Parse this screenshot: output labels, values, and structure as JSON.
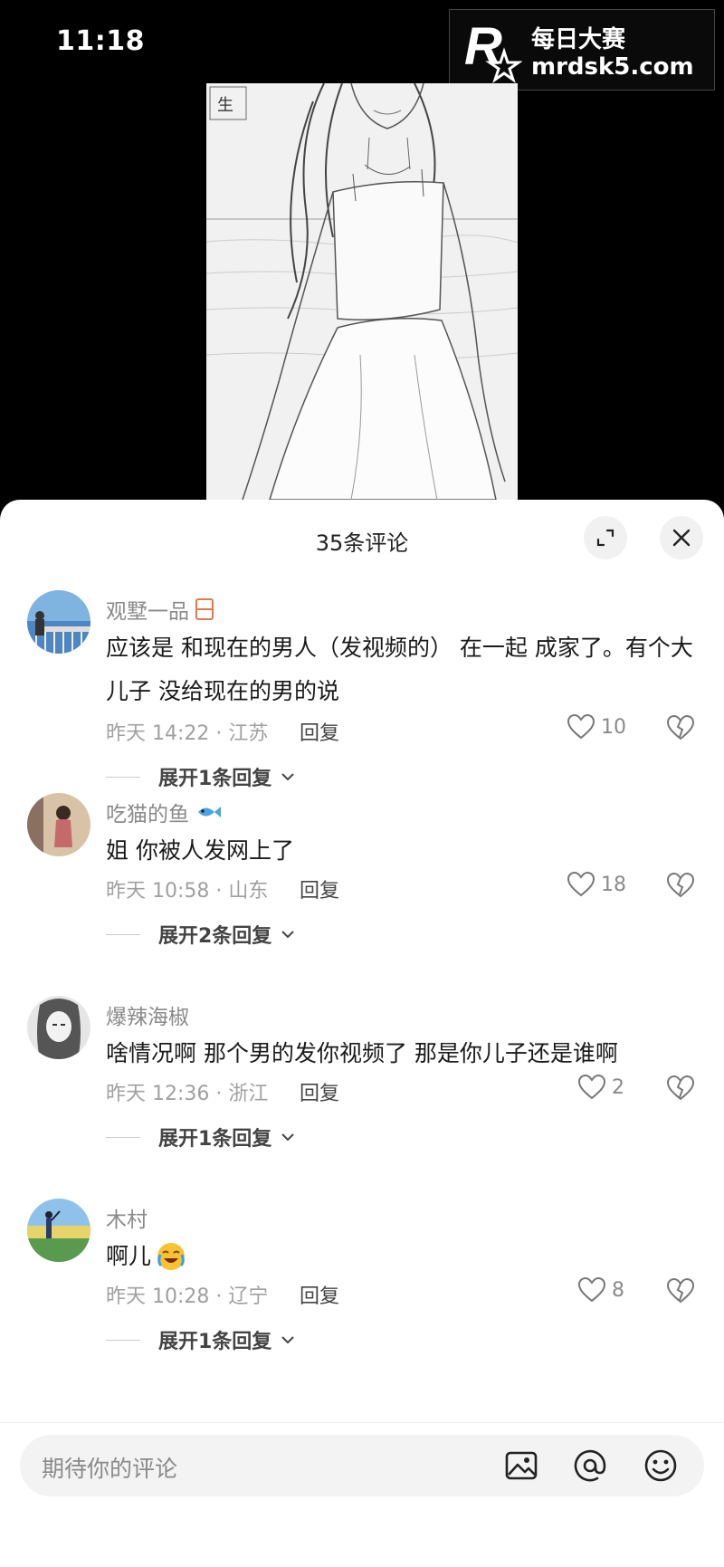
{
  "status": {
    "time": "11:18"
  },
  "watermark": {
    "title": "每日大赛",
    "url": "mrdsk5.com"
  },
  "sheet": {
    "title": "35条评论"
  },
  "comments": [
    {
      "username": "观墅一品",
      "text": "应该是 和现在的男人（发视频的） 在一起 成家了。有个大儿子 没给现在的男的说",
      "time": "昨天 14:22 · 江苏",
      "reply": "回复",
      "likes": "10",
      "expand": "展开1条回复"
    },
    {
      "username": "吃猫的鱼",
      "text": "姐 你被人发网上了",
      "time": "昨天 10:58 · 山东",
      "reply": "回复",
      "likes": "18",
      "expand": "展开2条回复"
    },
    {
      "username": "爆辣海椒",
      "text": "啥情况啊 那个男的发你视频了 那是你儿子还是谁啊",
      "time": "昨天 12:36 · 浙江",
      "reply": "回复",
      "likes": "2",
      "expand": "展开1条回复"
    },
    {
      "username": "木村",
      "text": "啊儿",
      "time": "昨天 10:28 · 辽宁",
      "reply": "回复",
      "likes": "8",
      "expand": "展开1条回复"
    }
  ],
  "input": {
    "placeholder": "期待你的评论"
  },
  "icons": [
    "expand-icon",
    "close-icon",
    "heart-icon",
    "broken-heart-icon",
    "chevron-down-icon",
    "image-icon",
    "at-icon",
    "emoji-icon"
  ],
  "colors": {
    "accent_text": "#1a1a1a",
    "muted": "#8a8a8a",
    "sheet_bg": "#ffffff",
    "video_bg": "#000000"
  }
}
